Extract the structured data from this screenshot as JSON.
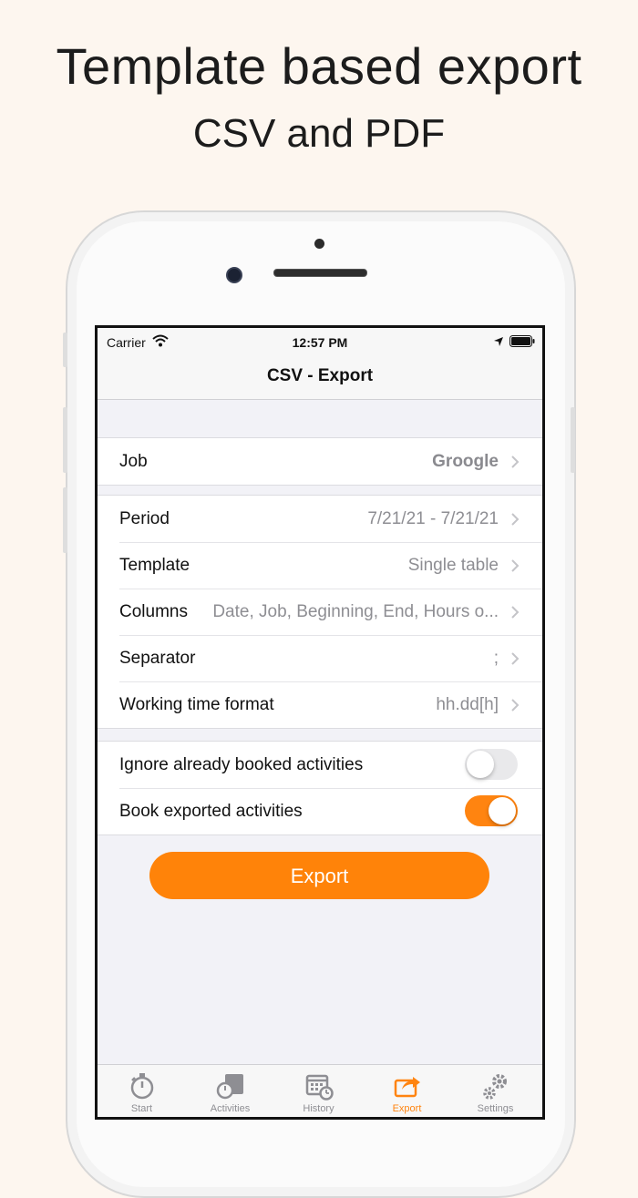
{
  "promo": {
    "title": "Template based export",
    "subtitle": "CSV and PDF"
  },
  "status_bar": {
    "carrier": "Carrier",
    "time": "12:57 PM"
  },
  "nav": {
    "title": "CSV - Export"
  },
  "settings": {
    "job": {
      "label": "Job",
      "value": "Groogle"
    },
    "period": {
      "label": "Period",
      "value": "7/21/21 - 7/21/21"
    },
    "template": {
      "label": "Template",
      "value": "Single table"
    },
    "columns": {
      "label": "Columns",
      "value": "Date, Job, Beginning, End, Hours o..."
    },
    "separator": {
      "label": "Separator",
      "value": ";"
    },
    "working_time_format": {
      "label": "Working time format",
      "value": "hh.dd[h]"
    }
  },
  "toggles": {
    "ignore_booked": {
      "label": "Ignore already booked activities",
      "on": false
    },
    "book_exported": {
      "label": "Book exported activities",
      "on": true
    }
  },
  "export_button": {
    "label": "Export"
  },
  "tabs": [
    {
      "label": "Start",
      "icon": "stopwatch-icon",
      "active": false
    },
    {
      "label": "Activities",
      "icon": "activities-icon",
      "active": false
    },
    {
      "label": "History",
      "icon": "calendar-clock-icon",
      "active": false
    },
    {
      "label": "Export",
      "icon": "share-export-icon",
      "active": true
    },
    {
      "label": "Settings",
      "icon": "gears-icon",
      "active": false
    }
  ],
  "colors": {
    "accent": "#ff8410",
    "background": "#fdf6ef",
    "secondary_text": "#8e8e93"
  }
}
